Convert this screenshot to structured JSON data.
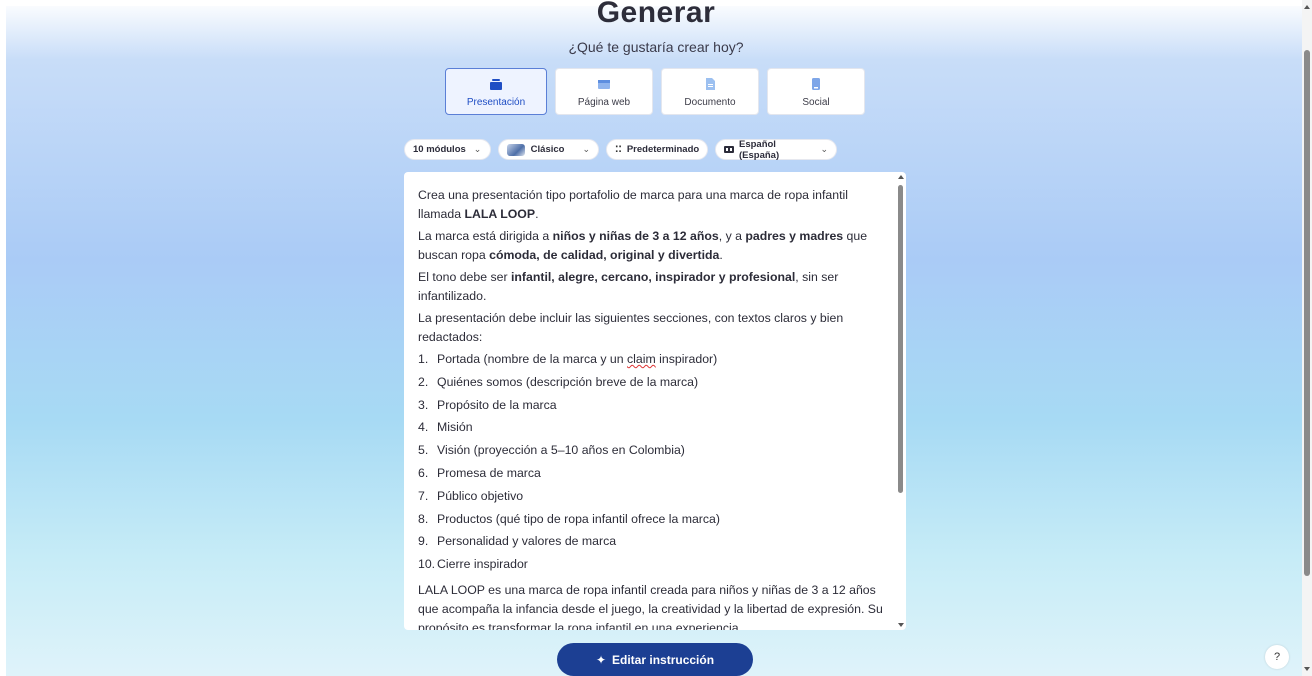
{
  "header": {
    "title": "Generar",
    "subtitle": "¿Qué te gustaría crear hoy?"
  },
  "types": [
    {
      "label": "Presentación",
      "icon": "presentation-icon",
      "selected": true
    },
    {
      "label": "Página web",
      "icon": "webpage-icon",
      "selected": false
    },
    {
      "label": "Documento",
      "icon": "document-icon",
      "selected": false
    },
    {
      "label": "Social",
      "icon": "social-icon",
      "selected": false
    }
  ],
  "options": {
    "modules": "10 módulos",
    "theme": "Clásico",
    "layout": "Predeterminado",
    "language": "Español (España)"
  },
  "prompt": {
    "intro_pre": "Crea una presentación tipo portafolio de marca para una marca de ropa infantil llamada ",
    "intro_brand": "LALA LOOP",
    "intro_post": ".",
    "audience_a": "La marca está dirigida a ",
    "audience_b": "niños y niñas de 3 a 12 años",
    "audience_c": ", y a ",
    "audience_d": "padres y madres",
    "audience_e": " que buscan ropa ",
    "audience_f": "cómoda, de calidad, original y divertida",
    "audience_g": ".",
    "tone_a": "El tono debe ser ",
    "tone_b": "infantil, alegre, cercano, inspirador y profesional",
    "tone_c": ", sin ser infantilizado.",
    "sections_intro": "La presentación debe incluir las siguientes secciones, con textos claros y bien redactados:",
    "item1_pre": "Portada (nombre de la marca y un ",
    "item1_word": "claim",
    "item1_post": " inspirador)",
    "items": [
      {
        "num": "1.",
        "text": ""
      },
      {
        "num": "2.",
        "text": "Quiénes somos (descripción breve de la marca)"
      },
      {
        "num": "3.",
        "text": "Propósito de la marca"
      },
      {
        "num": "4.",
        "text": "Misión"
      },
      {
        "num": "5.",
        "text": "Visión (proyección a 5–10 años en Colombia)"
      },
      {
        "num": "6.",
        "text": "Promesa de marca"
      },
      {
        "num": "7.",
        "text": "Público objetivo"
      },
      {
        "num": "8.",
        "text": "Productos (qué tipo de ropa infantil ofrece la marca)"
      },
      {
        "num": "9.",
        "text": "Personalidad y valores de marca"
      },
      {
        "num": "10.",
        "text": "Cierre inspirador"
      }
    ],
    "closing": "LALA LOOP es una marca de ropa infantil creada para niños y niñas de 3 a 12 años que acompaña la infancia desde el juego, la creatividad y la libertad de expresión. Su propósito es transformar la ropa infantil en una experiencia"
  },
  "actions": {
    "edit_label": "Editar instrucción",
    "help_label": "?"
  },
  "colors": {
    "primary_button": "#1c3f93",
    "selected_card_border": "#5b7fd6",
    "spellcheck": "#dd3333"
  }
}
